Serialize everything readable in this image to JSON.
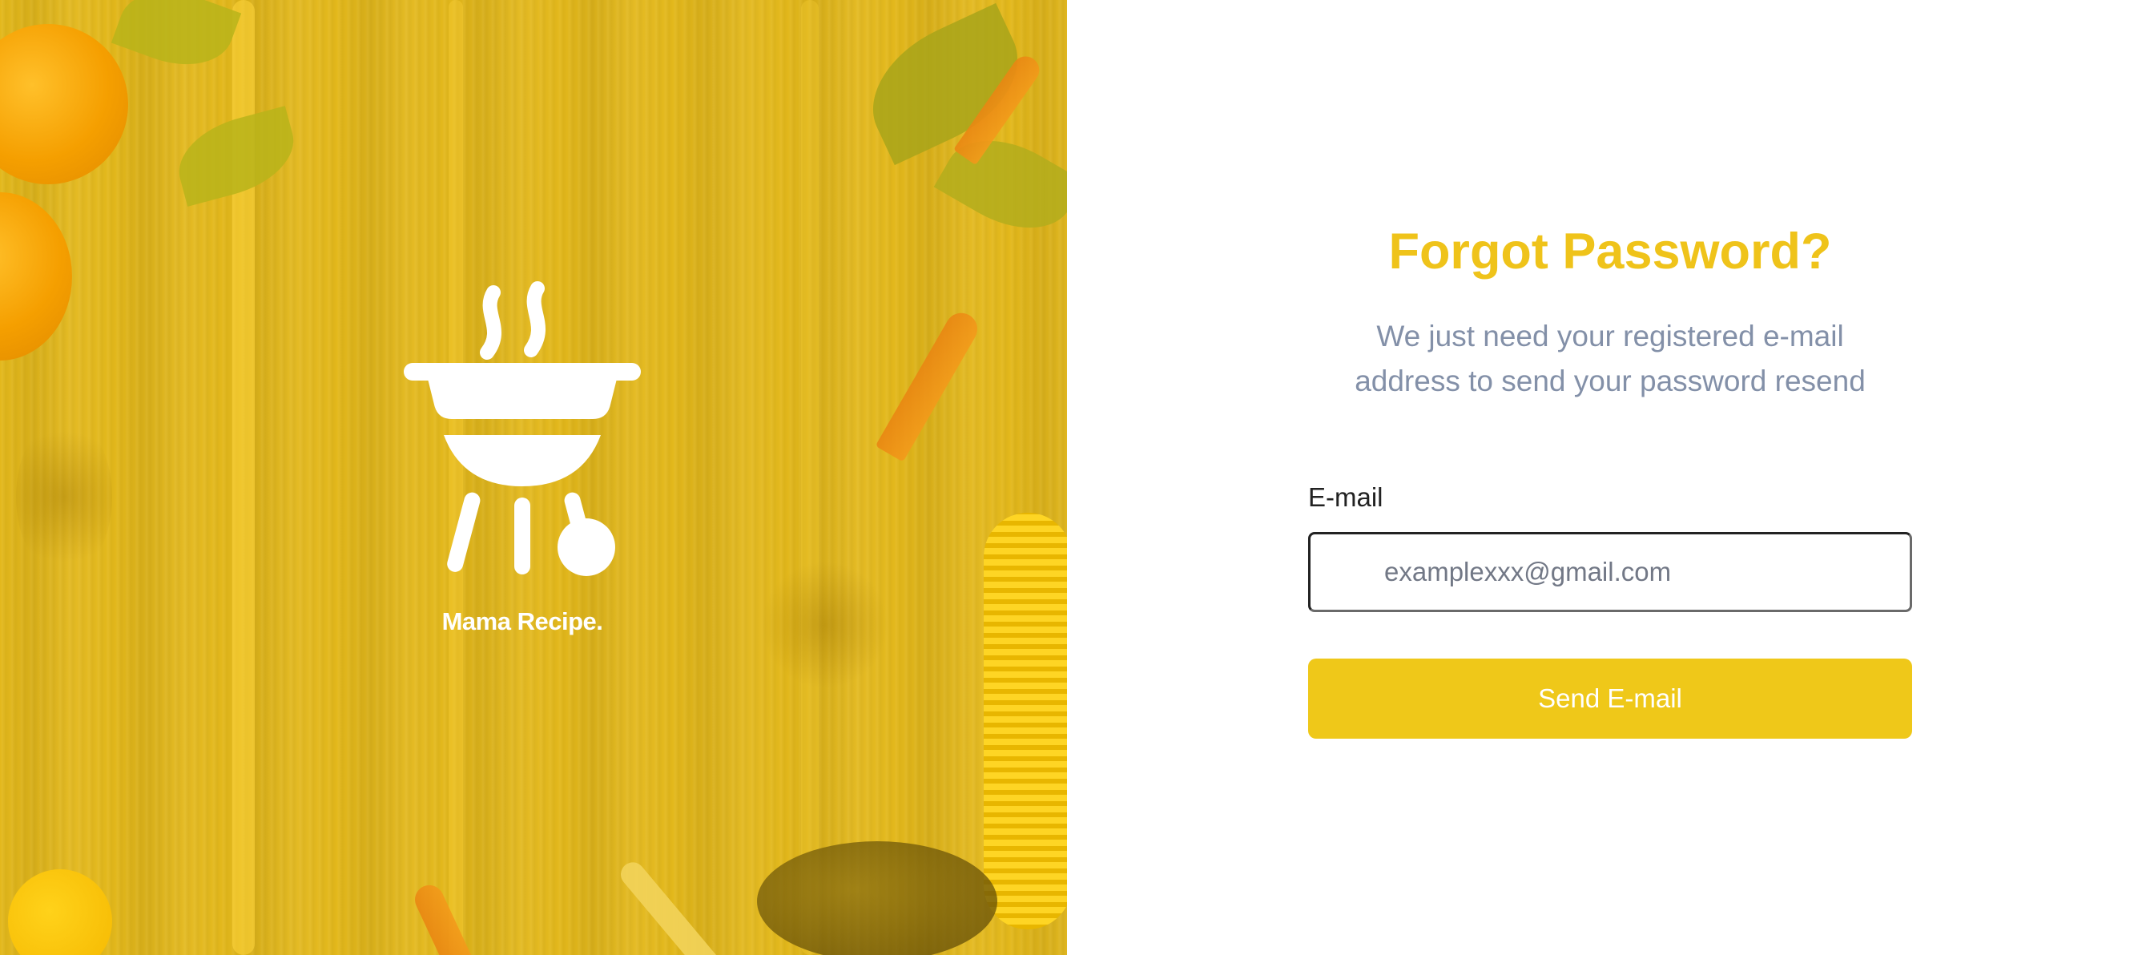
{
  "brand": {
    "name": "Mama Recipe.",
    "logo_icon": "barbecue-grill-icon",
    "accent_color": "#efc31a",
    "hero_overlay_color": "#e3b81b"
  },
  "form": {
    "title": "Forgot Password?",
    "subtitle_line1": "We just need your registered e-mail",
    "subtitle_line2": "address to send your password resend",
    "email_label": "E-mail",
    "email_placeholder": "examplexxx@gmail.com",
    "email_value": "",
    "submit_label": "Send E-mail",
    "button_color": "#efc819"
  }
}
